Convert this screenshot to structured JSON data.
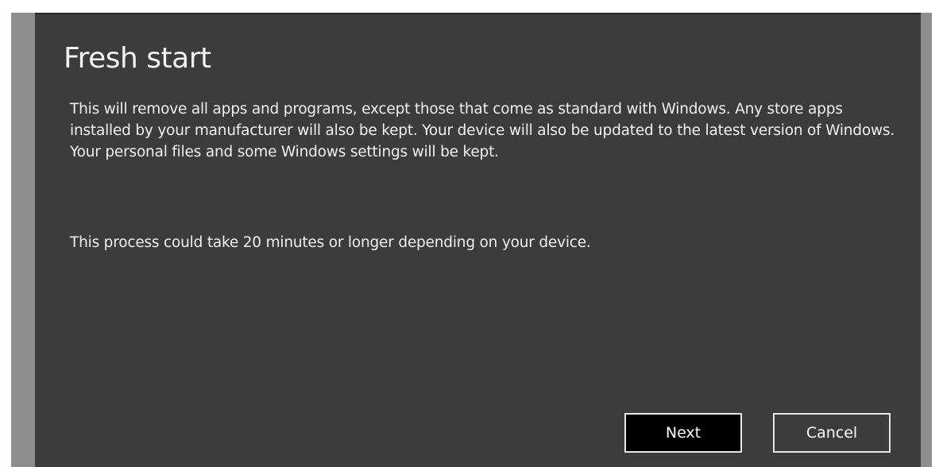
{
  "dialog": {
    "title": "Fresh start",
    "paragraphs": [
      "This will remove all apps and programs, except those that come as standard with Windows. Any store apps installed by your manufacturer will also be kept. Your device will also be updated to the latest version of Windows. Your personal files and some Windows settings will be kept.",
      "This process could take 20 minutes or longer depending on your device."
    ],
    "buttons": {
      "next_label": "Next",
      "cancel_label": "Cancel"
    }
  },
  "colors": {
    "dialog_background": "#3c3c3c",
    "side_gutter": "#8e8e8e",
    "primary_button": "#000000",
    "text": "#f0f0f0"
  }
}
